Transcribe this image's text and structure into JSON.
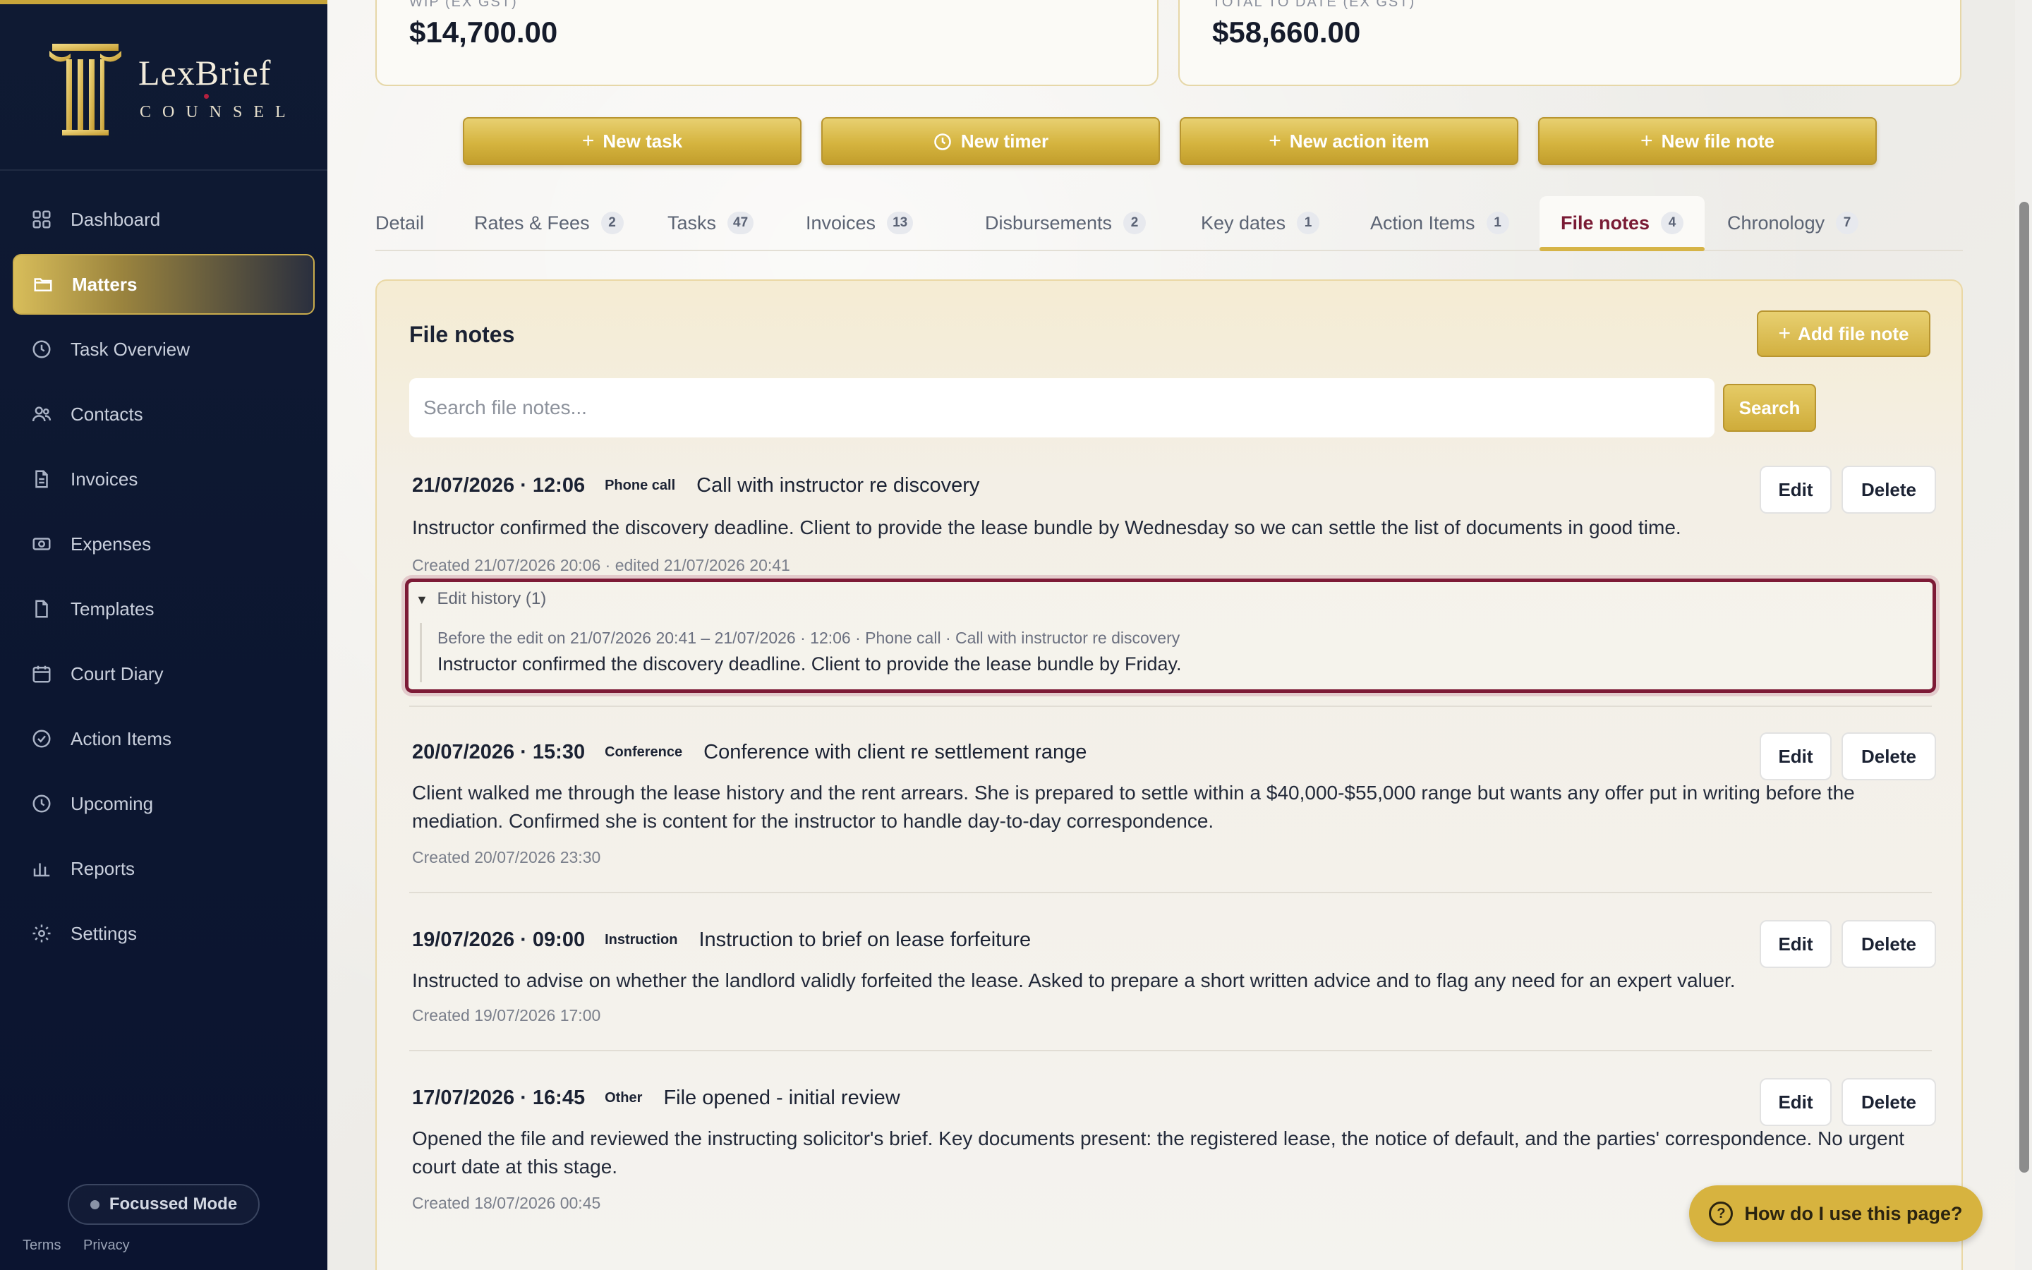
{
  "brand": {
    "name": "LexBrief",
    "sub": "COUNSEL"
  },
  "sidebar": {
    "items": [
      {
        "label": "Dashboard",
        "icon": "grid-icon"
      },
      {
        "label": "Matters",
        "icon": "folder-icon",
        "active": true
      },
      {
        "label": "Task Overview",
        "icon": "clock-icon"
      },
      {
        "label": "Contacts",
        "icon": "users-icon"
      },
      {
        "label": "Invoices",
        "icon": "document-icon"
      },
      {
        "label": "Expenses",
        "icon": "cash-icon"
      },
      {
        "label": "Templates",
        "icon": "file-icon"
      },
      {
        "label": "Court Diary",
        "icon": "calendar-icon"
      },
      {
        "label": "Action Items",
        "icon": "check-circle-icon"
      },
      {
        "label": "Upcoming",
        "icon": "clock-icon"
      },
      {
        "label": "Reports",
        "icon": "bar-chart-icon"
      },
      {
        "label": "Settings",
        "icon": "gear-icon"
      }
    ],
    "focus_mode": "Focussed Mode",
    "terms": "Terms",
    "privacy": "Privacy"
  },
  "stats": [
    {
      "label": "WIP (EX GST)",
      "value": "$14,700.00"
    },
    {
      "label": "TOTAL TO DATE (EX GST)",
      "value": "$58,660.00"
    }
  ],
  "actions": {
    "new_task": "New task",
    "new_timer": "New timer",
    "new_action_item": "New action item",
    "new_file_note": "New file note"
  },
  "tabs": [
    {
      "label": "Detail",
      "count": ""
    },
    {
      "label": "Rates & Fees",
      "count": "2"
    },
    {
      "label": "Tasks",
      "count": "47"
    },
    {
      "label": "Invoices",
      "count": "13"
    },
    {
      "label": "Disbursements",
      "count": "2"
    },
    {
      "label": "Key dates",
      "count": "1"
    },
    {
      "label": "Action Items",
      "count": "1"
    },
    {
      "label": "File notes",
      "count": "4",
      "active": true
    },
    {
      "label": "Chronology",
      "count": "7"
    }
  ],
  "file_notes": {
    "title": "File notes",
    "add_label": "Add file note",
    "search_placeholder": "Search file notes...",
    "search_label": "Search",
    "edit_label": "Edit",
    "delete_label": "Delete",
    "notes": [
      {
        "datetime": "21/07/2026 · 12:06",
        "type": "Phone call",
        "title": "Call with instructor re discovery",
        "body": "Instructor confirmed the discovery deadline. Client to provide the lease bundle by Wednesday so we can settle the list of documents in good time.",
        "meta": "Created 21/07/2026 20:06 · edited 21/07/2026 20:41",
        "history": {
          "summary": "Edit history (1)",
          "before": "Before the edit on 21/07/2026 20:41 – 21/07/2026 · 12:06 · Phone call · Call with instructor re discovery",
          "text": "Instructor confirmed the discovery deadline. Client to provide the lease bundle by Friday."
        }
      },
      {
        "datetime": "20/07/2026 · 15:30",
        "type": "Conference",
        "title": "Conference with client re settlement range",
        "body": "Client walked me through the lease history and the rent arrears. She is prepared to settle within a $40,000-$55,000 range but wants any offer put in writing before the mediation. Confirmed she is content for the instructor to handle day-to-day correspondence.",
        "meta": "Created 20/07/2026 23:30"
      },
      {
        "datetime": "19/07/2026 · 09:00",
        "type": "Instruction",
        "title": "Instruction to brief on lease forfeiture",
        "body": "Instructed to advise on whether the landlord validly forfeited the lease. Asked to prepare a short written advice and to flag any need for an expert valuer.",
        "meta": "Created 19/07/2026 17:00"
      },
      {
        "datetime": "17/07/2026 · 16:45",
        "type": "Other",
        "title": "File opened - initial review",
        "body": "Opened the file and reviewed the instructing solicitor's brief. Key documents present: the registered lease, the notice of default, and the parties' correspondence. No urgent court date at this stage.",
        "meta": "Created 18/07/2026 00:45"
      }
    ]
  },
  "help": "How do I use this page?"
}
